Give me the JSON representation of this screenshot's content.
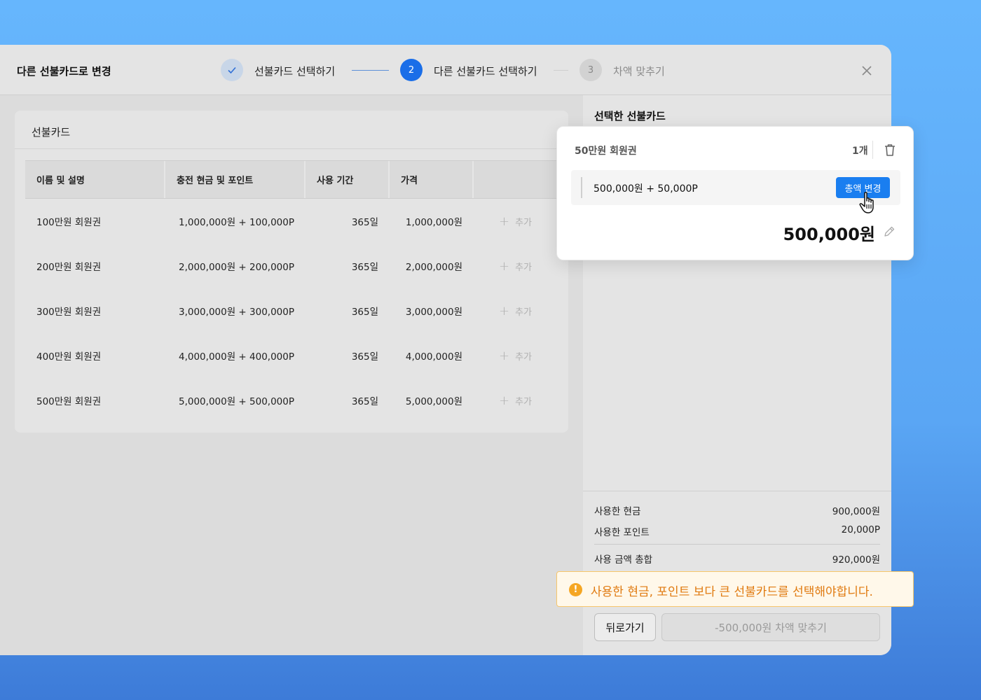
{
  "dialog": {
    "title": "다른 선불카드로 변경",
    "steps": [
      {
        "number": "✓",
        "label": "선불카드 선택하기",
        "state": "done"
      },
      {
        "number": "2",
        "label": "다른 선불카드 선택하기",
        "state": "active"
      },
      {
        "number": "3",
        "label": "차액 맞추기",
        "state": "pending"
      }
    ],
    "close_icon": "close-icon"
  },
  "left_panel": {
    "title": "선불카드",
    "columns": [
      "이름 및 설명",
      "충전 현금 및 포인트",
      "사용 기간",
      "가격",
      ""
    ],
    "rows": [
      {
        "name": "100만원 회원권",
        "charge": "1,000,000원 + 100,000P",
        "period": "365일",
        "price": "1,000,000원",
        "add": "추가"
      },
      {
        "name": "200만원 회원권",
        "charge": "2,000,000원 + 200,000P",
        "period": "365일",
        "price": "2,000,000원",
        "add": "추가"
      },
      {
        "name": "300만원 회원권",
        "charge": "3,000,000원 + 300,000P",
        "period": "365일",
        "price": "3,000,000원",
        "add": "추가"
      },
      {
        "name": "400만원 회원권",
        "charge": "4,000,000원 + 400,000P",
        "period": "365일",
        "price": "4,000,000원",
        "add": "추가"
      },
      {
        "name": "500만원 회원권",
        "charge": "5,000,000원 + 500,000P",
        "period": "365일",
        "price": "5,000,000원",
        "add": "추가"
      }
    ]
  },
  "right_panel": {
    "title": "선택한 선불카드",
    "summary": [
      {
        "label": "사용한 현금",
        "value": "900,000원"
      },
      {
        "label": "사용한 포인트",
        "value": "20,000P"
      },
      {
        "label": "사용 금액 총합",
        "value": "920,000원"
      }
    ],
    "back_label": "뒤로가기",
    "confirm_label": "-500,000원 차액 맞추기"
  },
  "selected_card": {
    "name": "50만원 회원권",
    "quantity": "1개",
    "detail": "500,000원 + 50,000P",
    "change_label": "총액 변경",
    "price": "500,000원"
  },
  "warning": {
    "icon": "!",
    "text": "사용한 현금, 포인트 보다 큰 선불카드를 선택해야합니다."
  },
  "colors": {
    "accent": "#1a7ef0",
    "warning": "#f5a623",
    "warning_text": "#e07a10"
  }
}
